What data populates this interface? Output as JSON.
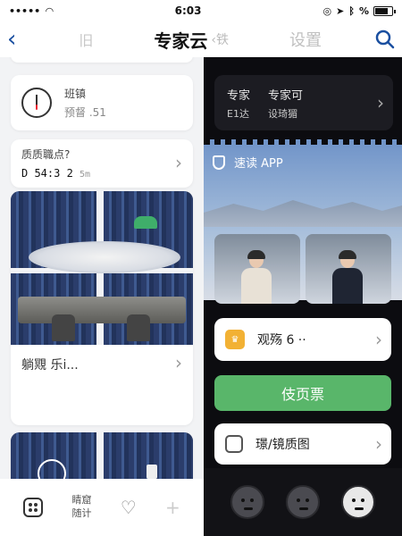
{
  "status_bar": {
    "time": "6:03",
    "wifi_icon": "wifi-icon",
    "battery_level": 0.8
  },
  "nav": {
    "back_glyph": "‹",
    "ghost_label": "旧",
    "title": "专家云",
    "ghost_title": "‹铁",
    "settings_label": "设置",
    "search_icon": "search-icon"
  },
  "left": {
    "clock_card": {
      "title": "班镇",
      "subtitle": "预督 .51"
    },
    "quality_card": {
      "title": "质质職点?",
      "value": "D 54:3 2",
      "unit": "5m"
    },
    "media_card": {
      "caption": "躺覭 乐i..."
    },
    "tab_bar": {
      "text_line1": "睛窟",
      "text_line2": "随计"
    }
  },
  "right": {
    "dark_card": {
      "col1_line1": "专家",
      "col1_line2": "E1达",
      "col2_line1": "专家可",
      "col2_line2": "设琦猸"
    },
    "read_app": "速读 APP",
    "viewers_row": {
      "label": "观殇 6 ··"
    },
    "green_button": "伎页票",
    "report_row": {
      "label": "璟/镜质图"
    }
  }
}
